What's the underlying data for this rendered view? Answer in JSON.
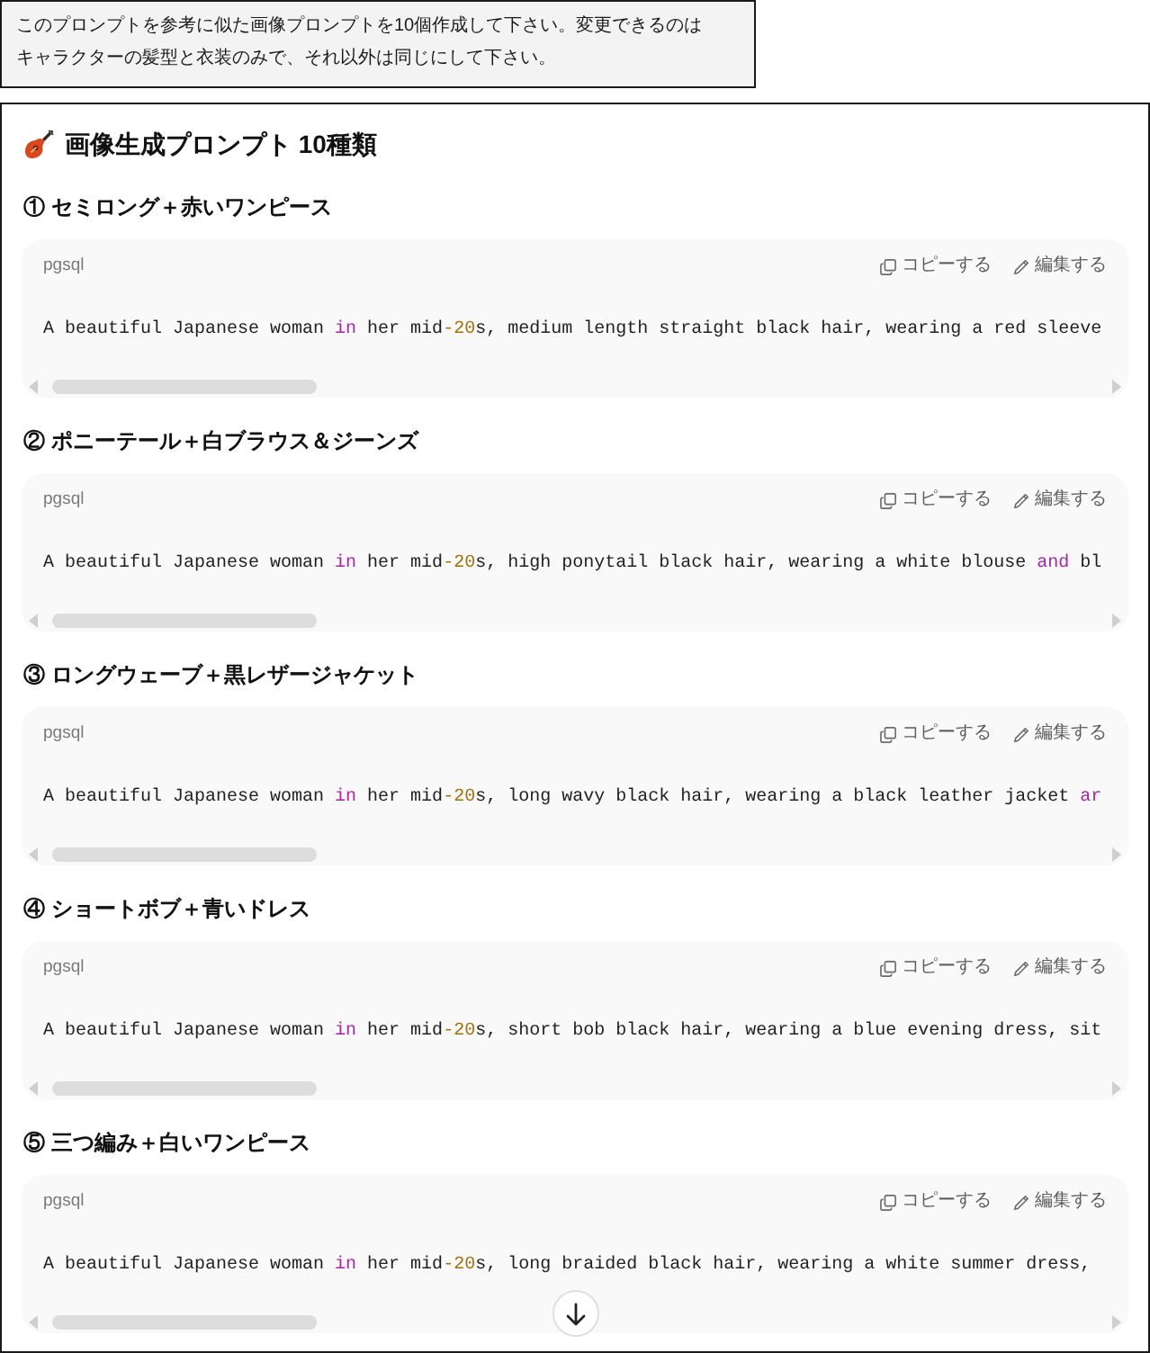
{
  "user_message": {
    "text": "このプロンプトを参考に似た画像プロンプトを10個作成して下さい。変更できるのはキャラクターの髪型と衣装のみで、それ以外は同じにして下さい。"
  },
  "response": {
    "title": "画像生成プロンプト 10種類",
    "sections": [
      {
        "heading": "① セミロング＋赤いワンピース",
        "code_block": {
          "language": "pgsql",
          "copy_label": "コピーする",
          "edit_label": "編集する",
          "code": [
            {
              "kind": "plain",
              "text": "A beautiful Japanese woman "
            },
            {
              "kind": "keyword",
              "text": "in"
            },
            {
              "kind": "plain",
              "text": " her mid"
            },
            {
              "kind": "number",
              "text": "-20"
            },
            {
              "kind": "plain",
              "text": "s, medium length straight black hair, wearing a red sleeve"
            }
          ]
        }
      },
      {
        "heading": "② ポニーテール＋白ブラウス＆ジーンズ",
        "code_block": {
          "language": "pgsql",
          "copy_label": "コピーする",
          "edit_label": "編集する",
          "code": [
            {
              "kind": "plain",
              "text": "A beautiful Japanese woman "
            },
            {
              "kind": "keyword",
              "text": "in"
            },
            {
              "kind": "plain",
              "text": " her mid"
            },
            {
              "kind": "number",
              "text": "-20"
            },
            {
              "kind": "plain",
              "text": "s, high ponytail black hair, wearing a white blouse "
            },
            {
              "kind": "keyword",
              "text": "and"
            },
            {
              "kind": "plain",
              "text": " bl"
            }
          ]
        }
      },
      {
        "heading": "③ ロングウェーブ＋黒レザージャケット",
        "code_block": {
          "language": "pgsql",
          "copy_label": "コピーする",
          "edit_label": "編集する",
          "code": [
            {
              "kind": "plain",
              "text": "A beautiful Japanese woman "
            },
            {
              "kind": "keyword",
              "text": "in"
            },
            {
              "kind": "plain",
              "text": " her mid"
            },
            {
              "kind": "number",
              "text": "-20"
            },
            {
              "kind": "plain",
              "text": "s, long wavy black hair, wearing a black leather jacket "
            },
            {
              "kind": "keyword",
              "text": "ar"
            }
          ]
        }
      },
      {
        "heading": "④ ショートボブ＋青いドレス",
        "code_block": {
          "language": "pgsql",
          "copy_label": "コピーする",
          "edit_label": "編集する",
          "code": [
            {
              "kind": "plain",
              "text": "A beautiful Japanese woman "
            },
            {
              "kind": "keyword",
              "text": "in"
            },
            {
              "kind": "plain",
              "text": " her mid"
            },
            {
              "kind": "number",
              "text": "-20"
            },
            {
              "kind": "plain",
              "text": "s, short bob black hair, wearing a blue evening dress, sit"
            }
          ]
        }
      },
      {
        "heading": "⑤ 三つ編み＋白いワンピース",
        "code_block": {
          "language": "pgsql",
          "copy_label": "コピーする",
          "edit_label": "編集する",
          "code": [
            {
              "kind": "plain",
              "text": "A beautiful Japanese woman "
            },
            {
              "kind": "keyword",
              "text": "in"
            },
            {
              "kind": "plain",
              "text": " her mid"
            },
            {
              "kind": "number",
              "text": "-20"
            },
            {
              "kind": "plain",
              "text": "s, long braided black hair, wearing a white summer dress,"
            }
          ]
        }
      }
    ]
  }
}
